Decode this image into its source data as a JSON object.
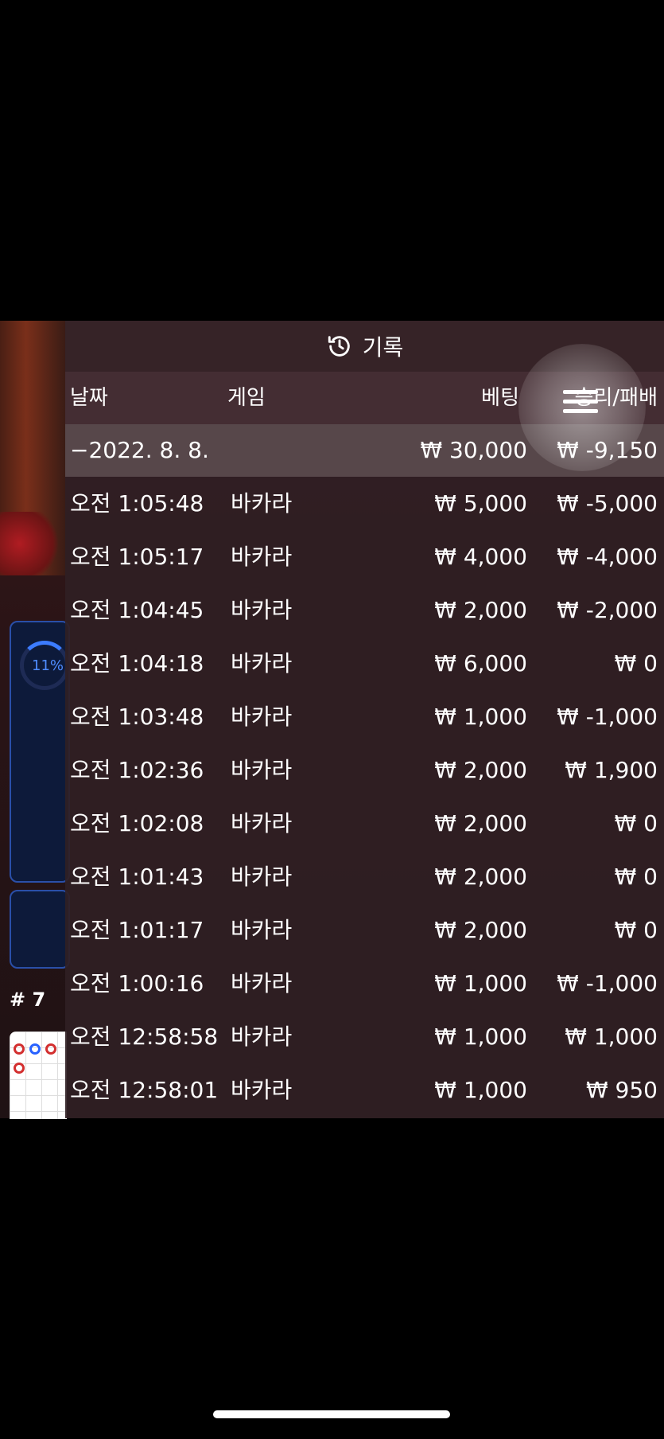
{
  "header": {
    "title": "기록"
  },
  "columns": {
    "date": "날짜",
    "game": "게임",
    "bet": "베팅",
    "result": "승리/패배"
  },
  "date_group": {
    "label": "−2022. 8. 8.",
    "bet_total": "₩ 30,000",
    "result_total": "₩ -9,150"
  },
  "rows": [
    {
      "time": "오전 1:05:48",
      "game": "바카라",
      "bet": "₩ 5,000",
      "result": "₩ -5,000"
    },
    {
      "time": "오전 1:05:17",
      "game": "바카라",
      "bet": "₩ 4,000",
      "result": "₩ -4,000"
    },
    {
      "time": "오전 1:04:45",
      "game": "바카라",
      "bet": "₩ 2,000",
      "result": "₩ -2,000"
    },
    {
      "time": "오전 1:04:18",
      "game": "바카라",
      "bet": "₩ 6,000",
      "result": "₩ 0"
    },
    {
      "time": "오전 1:03:48",
      "game": "바카라",
      "bet": "₩ 1,000",
      "result": "₩ -1,000"
    },
    {
      "time": "오전 1:02:36",
      "game": "바카라",
      "bet": "₩ 2,000",
      "result": "₩ 1,900"
    },
    {
      "time": "오전 1:02:08",
      "game": "바카라",
      "bet": "₩ 2,000",
      "result": "₩ 0"
    },
    {
      "time": "오전 1:01:43",
      "game": "바카라",
      "bet": "₩ 2,000",
      "result": "₩ 0"
    },
    {
      "time": "오전 1:01:17",
      "game": "바카라",
      "bet": "₩ 2,000",
      "result": "₩ 0"
    },
    {
      "time": "오전 1:00:16",
      "game": "바카라",
      "bet": "₩ 1,000",
      "result": "₩ -1,000"
    },
    {
      "time": "오전 12:58:58",
      "game": "바카라",
      "bet": "₩ 1,000",
      "result": "₩ 1,000"
    },
    {
      "time": "오전 12:58:01",
      "game": "바카라",
      "bet": "₩ 1,000",
      "result": "₩ 950"
    }
  ],
  "background": {
    "percent": "11%",
    "round": "# 7"
  },
  "icons": {
    "header": "history-clock-icon",
    "menu": "menu-icon"
  }
}
